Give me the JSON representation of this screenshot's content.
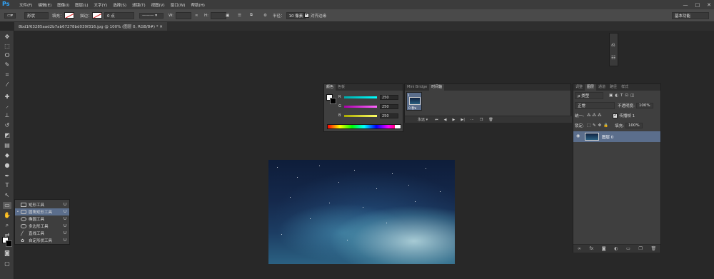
{
  "app": {
    "logo": "Ps"
  },
  "menu": [
    "文件(F)",
    "编辑(E)",
    "图像(I)",
    "图层(L)",
    "文字(Y)",
    "选择(S)",
    "滤镜(T)",
    "视图(V)",
    "窗口(W)",
    "帮助(H)"
  ],
  "window_controls": [
    "—",
    "□",
    "✕"
  ],
  "options": {
    "mode": "形状",
    "fill_label": "填充：",
    "stroke_label": "描边：",
    "stroke_width": "0 点",
    "w_label": "W:",
    "h_label": "H:",
    "radius_label": "半径：",
    "radius_value": "10 像素",
    "align_edges_label": "对齐边缘",
    "workspace": "基本功能"
  },
  "document_tab": "8bd1f63285aad2b7ab67278bd039f316.jpg @ 100% (图层 0, RGB/8#) * ✕",
  "flyout": {
    "items": [
      {
        "label": "矩形工具",
        "key": "U",
        "selected": false
      },
      {
        "label": "圆角矩形工具",
        "key": "U",
        "selected": true
      },
      {
        "label": "椭圆工具",
        "key": "U",
        "selected": false
      },
      {
        "label": "多边形工具",
        "key": "U",
        "selected": false
      },
      {
        "label": "直线工具",
        "key": "U",
        "selected": false
      },
      {
        "label": "自定形状工具",
        "key": "U",
        "selected": false
      }
    ]
  },
  "color_panel": {
    "tabs": [
      "颜色",
      "色板"
    ],
    "sliders": [
      {
        "label": "R",
        "value": "250",
        "color": "#00c8ff"
      },
      {
        "label": "G",
        "value": "250",
        "color": "#e040e0"
      },
      {
        "label": "B",
        "value": "250",
        "color": "#e8e040"
      }
    ]
  },
  "bridge_panel": {
    "tabs": [
      "Mini Bridge",
      "时间轴"
    ],
    "frame_label": "0 秒▾",
    "loop_label": "永远 ▾"
  },
  "layers_panel": {
    "tabs": [
      "调整",
      "图层",
      "通道",
      "路径",
      "样式"
    ],
    "kind_filter": "ρ 类型",
    "blend_mode": "正常",
    "opacity_label": "不透明度:",
    "opacity_value": "100%",
    "lock_label": "锁定:",
    "fill_label": "填充:",
    "fill_value": "100%",
    "unify_label": "统一:",
    "propagate_label": "传播帧 1",
    "layer_name": "图层 0"
  }
}
